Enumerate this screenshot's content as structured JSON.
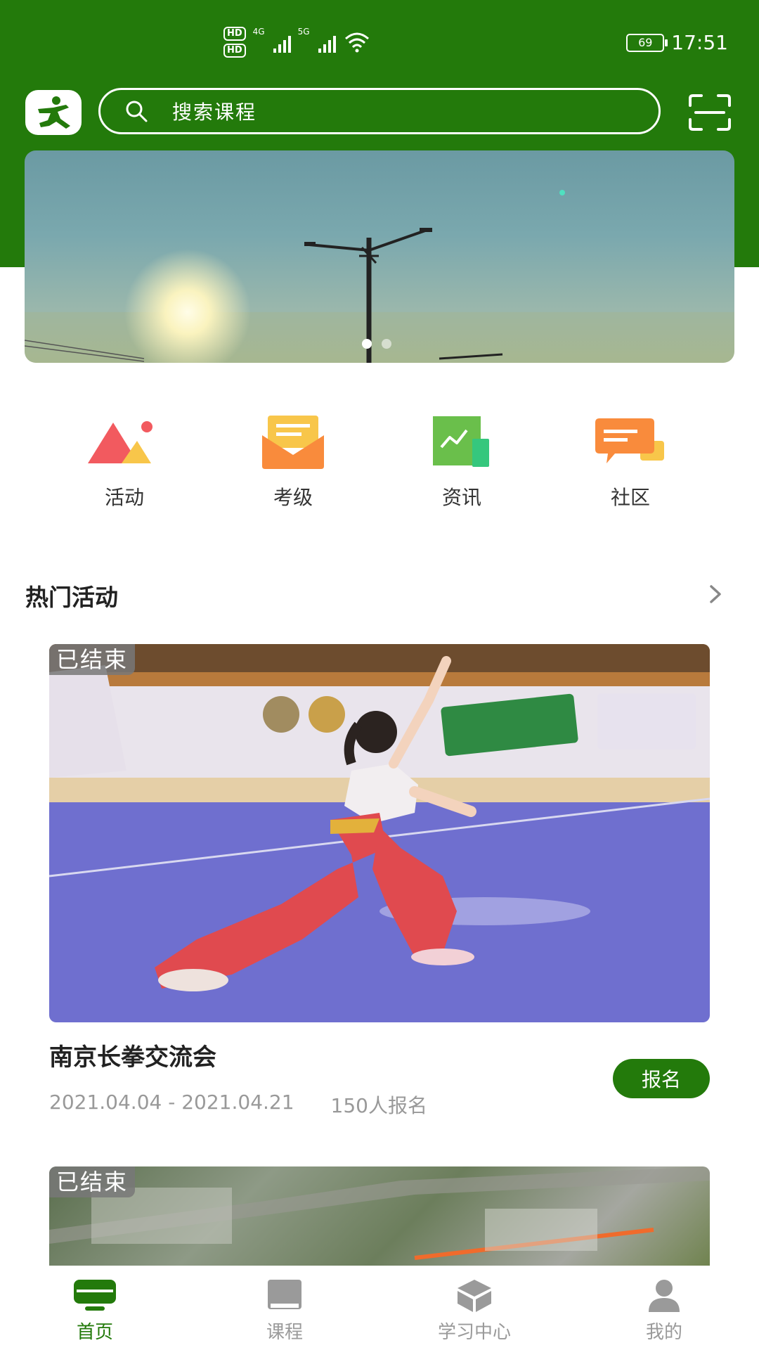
{
  "status_bar": {
    "hd1": "HD",
    "hd2": "HD",
    "sim1": "4G",
    "sim2": "5G",
    "battery": "69",
    "time": "17:51"
  },
  "header": {
    "search_placeholder": "搜索课程"
  },
  "banner": {
    "slide_count": 2,
    "active_slide": 1
  },
  "quick_menu": [
    {
      "label": "活动",
      "icon": "mountain-image-icon"
    },
    {
      "label": "考级",
      "icon": "envelope-icon"
    },
    {
      "label": "资讯",
      "icon": "chart-news-icon"
    },
    {
      "label": "社区",
      "icon": "chat-bubble-icon"
    }
  ],
  "hot_section": {
    "title": "热门活动"
  },
  "cards": [
    {
      "badge": "已结束",
      "title": "南京长拳交流会",
      "date_range": "2021.04.04 - 2021.04.21",
      "signups": "150人报名",
      "button": "报名"
    },
    {
      "badge": "已结束"
    }
  ],
  "tabbar": [
    {
      "label": "首页",
      "icon": "home-icon",
      "active": true
    },
    {
      "label": "课程",
      "icon": "book-icon",
      "active": false
    },
    {
      "label": "学习中心",
      "icon": "cube-icon",
      "active": false
    },
    {
      "label": "我的",
      "icon": "user-icon",
      "active": false
    }
  ],
  "colors": {
    "brand_green": "#237a0b",
    "muted_text": "#999999"
  }
}
